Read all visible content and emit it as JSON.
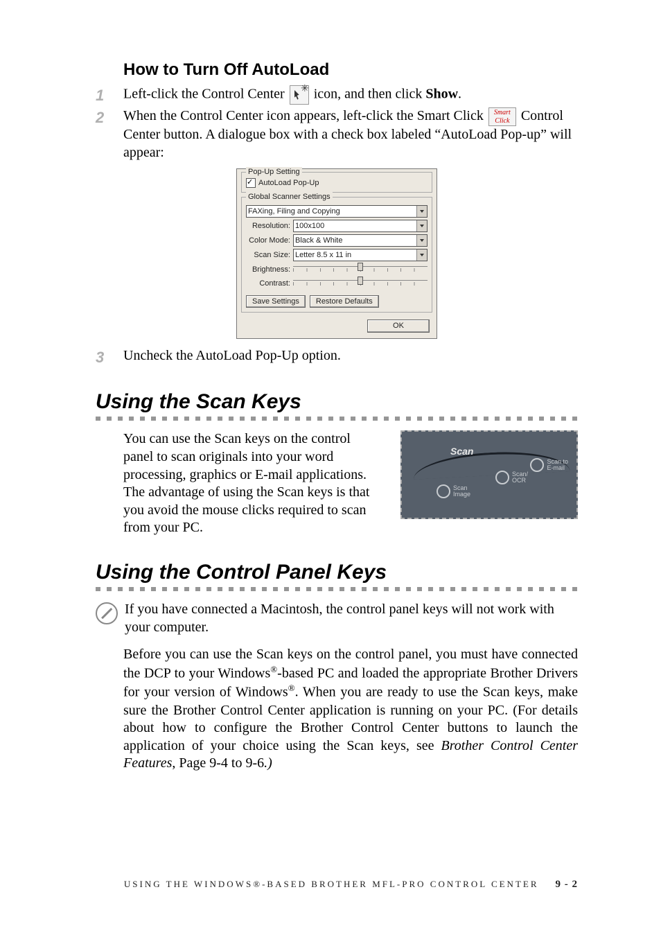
{
  "heading": "How to Turn Off AutoLoad",
  "steps": {
    "n1": "1",
    "n2": "2",
    "n3": "3",
    "s1_a": "Left-click the Control Center ",
    "s1_b": " icon, and then click ",
    "s1_show": "Show",
    "s1_c": ".",
    "s2_a": "When the Control Center icon appears, left-click the Smart Click ",
    "s2_b": " Control Center button. A dialogue box with a check box labeled “AutoLoad Pop-up” will appear:",
    "s3": "Uncheck the AutoLoad Pop-Up option."
  },
  "smart_click_text": "Smart\nClick",
  "dialog": {
    "popup_group": "Pop-Up Setting",
    "autoload_label": "AutoLoad Pop-Up",
    "global_group": "Global Scanner Settings",
    "profile": "FAXing, Filing and Copying",
    "resolution_label": "Resolution:",
    "resolution_value": "100x100",
    "colormode_label": "Color Mode:",
    "colormode_value": "Black & White",
    "scansize_label": "Scan Size:",
    "scansize_value": "Letter 8.5 x 11 in",
    "brightness_label": "Brightness:",
    "contrast_label": "Contrast:",
    "save_btn": "Save Settings",
    "restore_btn": "Restore Defaults",
    "ok_btn": "OK"
  },
  "section_scan_keys": "Using the Scan Keys",
  "scan_keys_para": "You can use the Scan keys on the control panel to scan originals into your word processing, graphics or E-mail applications. The advantage of using the Scan keys is that you avoid the mouse clicks required to scan from your PC.",
  "scan_graphic": {
    "title": "Scan",
    "email": "Scan to\nE-mail",
    "ocr": "Scan/\nOCR",
    "image": "Scan\nImage"
  },
  "section_control_panel": "Using the Control Panel Keys",
  "note_text": "If you have connected a Macintosh, the control panel keys will not work with your computer.",
  "body_para": {
    "a": "Before you can use the Scan keys on the control panel, you must have connected the DCP to your Windows",
    "b": "-based PC and loaded the appropriate Brother Drivers for your version of Windows",
    "c": ". When you are ready to use the Scan keys, make sure the Brother Control Center application is running on your PC. (For details about how to configure the Brother Control Center buttons to launch the application of your choice using the Scan keys, see ",
    "link": "Brother Control Center Features",
    "d": ", Page 9-4 to 9-6",
    "period": ".)"
  },
  "footer": {
    "title": "USING THE WINDOWS®-BASED BROTHER MFL-PRO CONTROL CENTER",
    "page": "9 - 2"
  }
}
